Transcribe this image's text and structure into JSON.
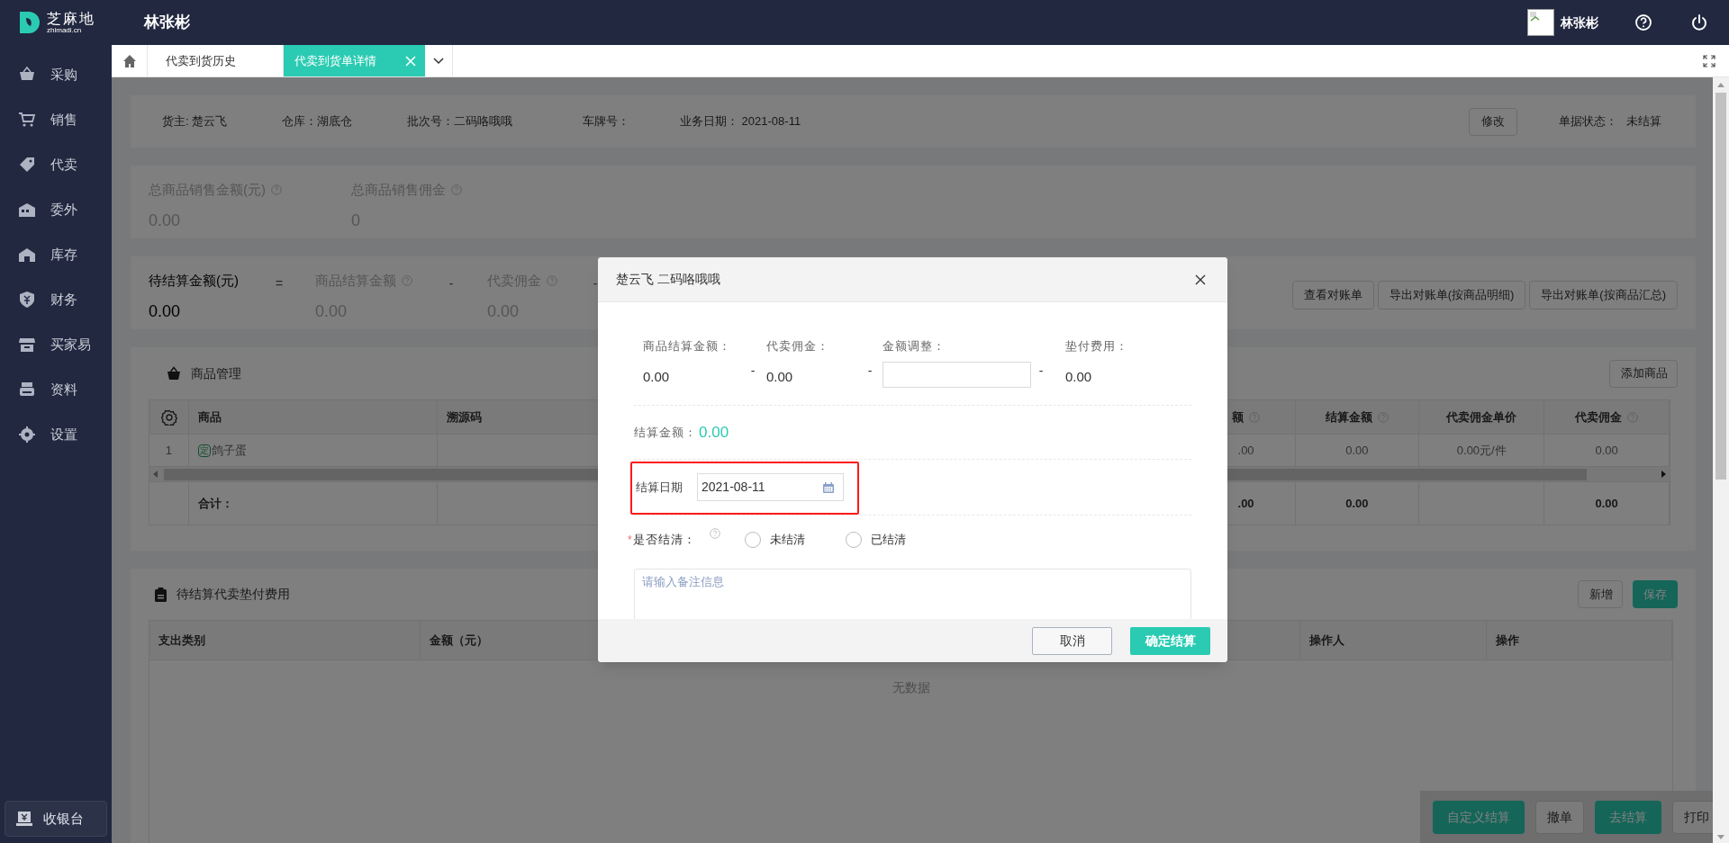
{
  "header": {
    "brand": "芝麻地",
    "brand_sub": "zhimadi.cn",
    "title": "林张彬",
    "user": "林张彬"
  },
  "sidebar": {
    "items": [
      "采购",
      "销售",
      "代卖",
      "委外",
      "库存",
      "财务",
      "买家易",
      "资料",
      "设置"
    ],
    "footer_button": "收银台"
  },
  "tabs": [
    {
      "label": "代卖到货历史",
      "selected": false,
      "closable": false
    },
    {
      "label": "代卖到货单详情",
      "selected": true,
      "closable": true
    }
  ],
  "info": {
    "fields": [
      "货主: 楚云飞",
      "仓库：湖底仓",
      "批次号：二码咯哦哦",
      "车牌号：",
      "业务日期：  2021-08-11"
    ],
    "edit_button": "修改",
    "status_label": "单据状态：",
    "status_value": "未结算"
  },
  "totals": [
    {
      "label": "总商品销售金额(元)",
      "help": true,
      "value": "0.00"
    },
    {
      "label": "总商品销售佣金",
      "help": true,
      "value": "0"
    }
  ],
  "settlement": {
    "items": [
      {
        "label": "待结算金额(元)",
        "help": false,
        "value": "0.00",
        "primary": true,
        "op": "="
      },
      {
        "label": "商品结算金额",
        "help": true,
        "value": "0.00",
        "primary": false,
        "op": "-"
      },
      {
        "label": "代卖佣金",
        "help": true,
        "value": "0.00",
        "primary": false,
        "op": "-"
      }
    ],
    "buttons": [
      "查看对账单",
      "导出对账单(按商品明细)",
      "导出对账单(按商品汇总)"
    ]
  },
  "goods": {
    "title": "商品管理",
    "add_button": "添加商品",
    "columns": [
      {
        "label": "商品",
        "help": false
      },
      {
        "label": "溯源码",
        "help": false
      },
      {
        "label": "额",
        "help": true
      },
      {
        "label": "结算金额",
        "help": true
      },
      {
        "label": "代卖佣金单价",
        "help": false
      },
      {
        "label": "代卖佣金",
        "help": true
      }
    ],
    "rows": [
      {
        "index": "1",
        "tag": "定",
        "name": "鸽子蛋",
        "values": [
          ".00",
          "0.00",
          "0.00元/件",
          "0.00"
        ]
      }
    ],
    "total_row": {
      "label": "合计：",
      "values": [
        ".00",
        "0.00"
      ],
      "commission": "0.00"
    }
  },
  "fees": {
    "title": "待结算代卖垫付费用",
    "buttons": [
      {
        "label": "新增",
        "primary": false
      },
      {
        "label": "保存",
        "primary": true
      }
    ],
    "columns": [
      "支出类别",
      "金额（元）",
      "操作人",
      "操作"
    ],
    "empty_text": "无数据"
  },
  "actions": [
    {
      "label": "自定义结算",
      "primary": true
    },
    {
      "label": "撤单",
      "primary": false
    },
    {
      "label": "去结算",
      "primary": true
    },
    {
      "label": "打印",
      "primary": false
    }
  ],
  "dialog": {
    "title": "楚云飞 二码咯哦哦",
    "amounts": [
      {
        "label": "商品结算金额：",
        "kind": "value",
        "value": "0.00",
        "op": "-"
      },
      {
        "label": "代卖佣金：",
        "kind": "value",
        "value": "0.00",
        "op": "-"
      },
      {
        "label": "金额调整：",
        "kind": "input",
        "op": "-"
      },
      {
        "label": "垫付费用：",
        "kind": "value",
        "value": "0.00"
      }
    ],
    "settlement_label": "结算金额：",
    "settlement_value": "0.00",
    "date_label": "结算日期",
    "date_value": "2021-08-11",
    "date_highlighted": true,
    "cleared": {
      "required_mark": "*",
      "label": "是否结清：",
      "help": true,
      "options": [
        {
          "label": "未结清",
          "selected": false
        },
        {
          "label": "已结清",
          "selected": false
        }
      ]
    },
    "note_placeholder": "请输入备注信息",
    "cancel": "取消",
    "confirm": "确定结算"
  }
}
